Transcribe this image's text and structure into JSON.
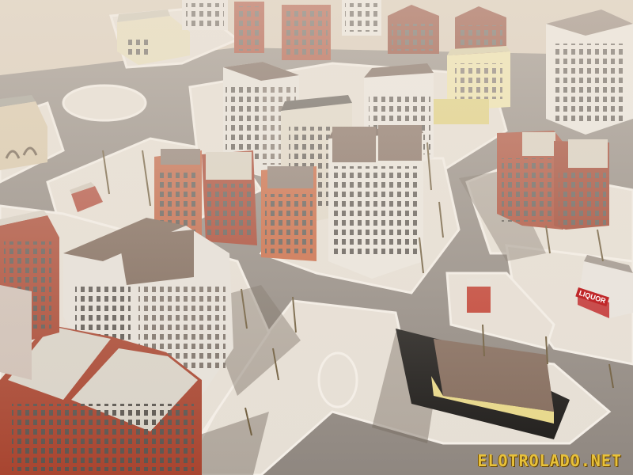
{
  "scene": {
    "kind": "isometric city render",
    "watermark": "ELOTROLADO.NET",
    "shop_sign": "LIQUOR"
  },
  "colors": {
    "ground": "#d9cbb8",
    "road": "#8f8780",
    "sidewalk": "#e8e2da",
    "brick": "#a5402c",
    "terracotta": "#c06040",
    "white_stone": "#e8e4de",
    "roof_dark": "#6e5a50",
    "watermark": "#e8c23a"
  }
}
